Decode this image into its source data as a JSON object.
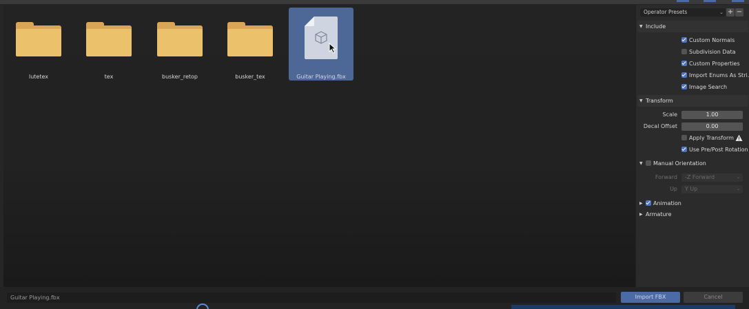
{
  "browser": {
    "items": [
      {
        "name": "lutetex",
        "type": "folder"
      },
      {
        "name": "tex",
        "type": "folder"
      },
      {
        "name": "busker_retop",
        "type": "folder"
      },
      {
        "name": "busker_tex",
        "type": "folder"
      },
      {
        "name": "Guitar Playing.fbx",
        "type": "file",
        "selected": true
      }
    ]
  },
  "panel": {
    "presets": {
      "label": "Operator Presets",
      "add": "+",
      "remove": "−"
    },
    "include": {
      "title": "Include",
      "options": [
        {
          "label": "Custom Normals",
          "checked": true
        },
        {
          "label": "Subdivision Data",
          "checked": false
        },
        {
          "label": "Custom Properties",
          "checked": true
        },
        {
          "label": "Import Enums As Stri...",
          "checked": true
        },
        {
          "label": "Image Search",
          "checked": true
        }
      ]
    },
    "transform": {
      "title": "Transform",
      "scale_label": "Scale",
      "scale_value": "1.00",
      "decal_label": "Decal Offset",
      "decal_value": "0.00",
      "apply_transform": {
        "label": "Apply Transform",
        "checked": false
      },
      "use_prepost": {
        "label": "Use Pre/Post Rotation",
        "checked": true
      }
    },
    "manual_orientation": {
      "title": "Manual Orientation",
      "checked": false,
      "forward_label": "Forward",
      "forward_value": "-Z Forward",
      "up_label": "Up",
      "up_value": "Y Up"
    },
    "animation": {
      "title": "Animation",
      "checked": true
    },
    "armature": {
      "title": "Armature"
    }
  },
  "footer": {
    "filename": "Guitar Playing.fbx",
    "import_label": "Import FBX",
    "cancel_label": "Cancel"
  },
  "colors": {
    "accent": "#4d6897",
    "checkbox_on": "#4d74c8",
    "folder": "#ebc16b"
  }
}
